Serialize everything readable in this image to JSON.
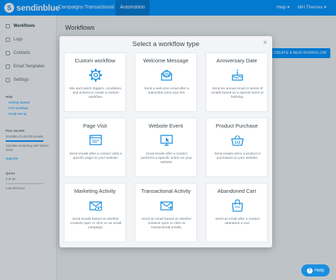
{
  "topnav": {
    "logo_mark": "S",
    "logo_text": "sendinblue",
    "links": [
      "Campaigns",
      "Transactional",
      "Automation"
    ],
    "help": "Help ▾",
    "account": "MH Themes ▾"
  },
  "sidebar": {
    "items": [
      "Workflows",
      "Logs",
      "Contacts",
      "Email Templates",
      "Settings"
    ],
    "help_heading": "Help",
    "help_links": [
      "Getting started",
      "First workflow",
      "Script set-up"
    ],
    "plan_label": "Plan SILVER",
    "plan_usage": "119,996 of 120,000 emails",
    "plan_remaining": "119,996 remaining until 10/oct-2018",
    "plan_link": "Upgrade",
    "quota_label": "Quota",
    "quota_value": "0 of 40",
    "quota_note": "Last this hour"
  },
  "main": {
    "title": "Workflows",
    "create_button": "CREATE A NEW WORKFLOW"
  },
  "modal": {
    "title": "Select a workflow type",
    "close": "×",
    "cards": [
      {
        "title": "Custom workflow",
        "desc": "Mix and match triggers, conditions, and actions to create a custom workflow.",
        "icon": "gear-icon"
      },
      {
        "title": "Welcome Message",
        "desc": "Send a welcome email after a subscriber joins your list.",
        "icon": "envelope-open-icon"
      },
      {
        "title": "Anniversary Date",
        "desc": "Send an annual email or series of emails based on a special event or birthday.",
        "icon": "cake-icon"
      },
      {
        "title": "Page Visit",
        "desc": "Send emails after a contact visits a specific page on your website.",
        "icon": "browser-window-icon"
      },
      {
        "title": "Website Event",
        "desc": "Send emails after a contact performs a specific action on your website.",
        "icon": "monitor-click-icon"
      },
      {
        "title": "Product Purchase",
        "desc": "Send emails when a product is purchased on your website.",
        "icon": "shopping-basket-icon"
      },
      {
        "title": "Marketing Activity",
        "desc": "Send emails based on whether contacts open or click on an email campaign.",
        "icon": "email-eye-icon"
      },
      {
        "title": "Transactional Activity",
        "desc": "Send an email based on whether contacts open or click on transactional emails.",
        "icon": "email-arrow-icon"
      },
      {
        "title": "Abandoned Cart",
        "desc": "Send an email after a contact abandons a cart.",
        "icon": "shopping-bag-icon"
      }
    ]
  },
  "help_button": {
    "label": "Help",
    "icon": "?"
  },
  "colors": {
    "brand": "#0092ff",
    "nav_active": "#0078d4",
    "icon_blue": "#1b8fe0"
  }
}
